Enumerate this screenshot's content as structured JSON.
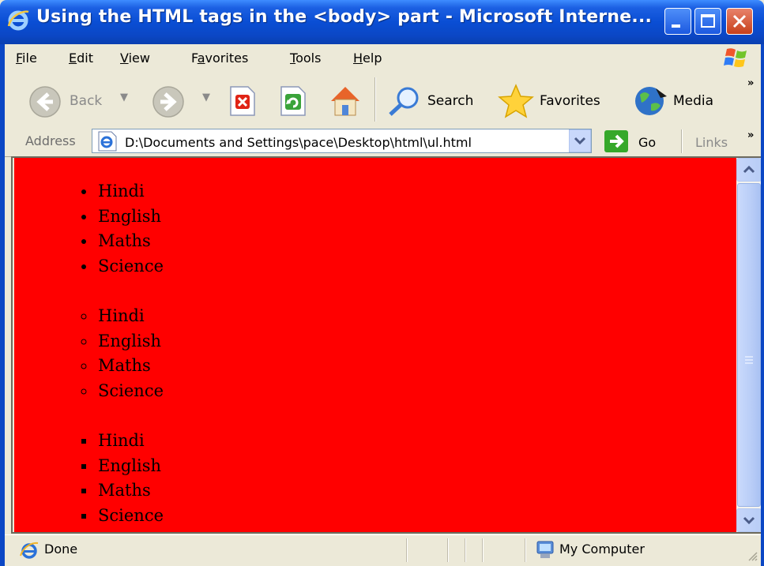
{
  "window": {
    "title": "Using the HTML tags in the <body> part - Microsoft Interne...",
    "buttons": {
      "minimize": "minimize",
      "maximize": "maximize",
      "close": "close"
    }
  },
  "menu": [
    "File",
    "Edit",
    "View",
    "Favorites",
    "Tools",
    "Help"
  ],
  "toolbar": {
    "back_label": "Back",
    "search_label": "Search",
    "favorites_label": "Favorites",
    "media_label": "Media"
  },
  "address": {
    "label": "Address",
    "url": "D:\\Documents and Settings\\pace\\Desktop\\html\\ul.html",
    "go_label": "Go",
    "links_label": "Links"
  },
  "content": {
    "background_color": "#ff0000",
    "lists": [
      {
        "style": "disc",
        "items": [
          "Hindi",
          "English",
          "Maths",
          "Science"
        ]
      },
      {
        "style": "circle",
        "items": [
          "Hindi",
          "English",
          "Maths",
          "Science"
        ]
      },
      {
        "style": "square",
        "items": [
          "Hindi",
          "English",
          "Maths",
          "Science"
        ]
      }
    ]
  },
  "status": {
    "text": "Done",
    "zone": "My Computer"
  },
  "colors": {
    "titlebar": "#0a4ed4",
    "chrome": "#ece9d8",
    "page_background": "#ff0000"
  }
}
